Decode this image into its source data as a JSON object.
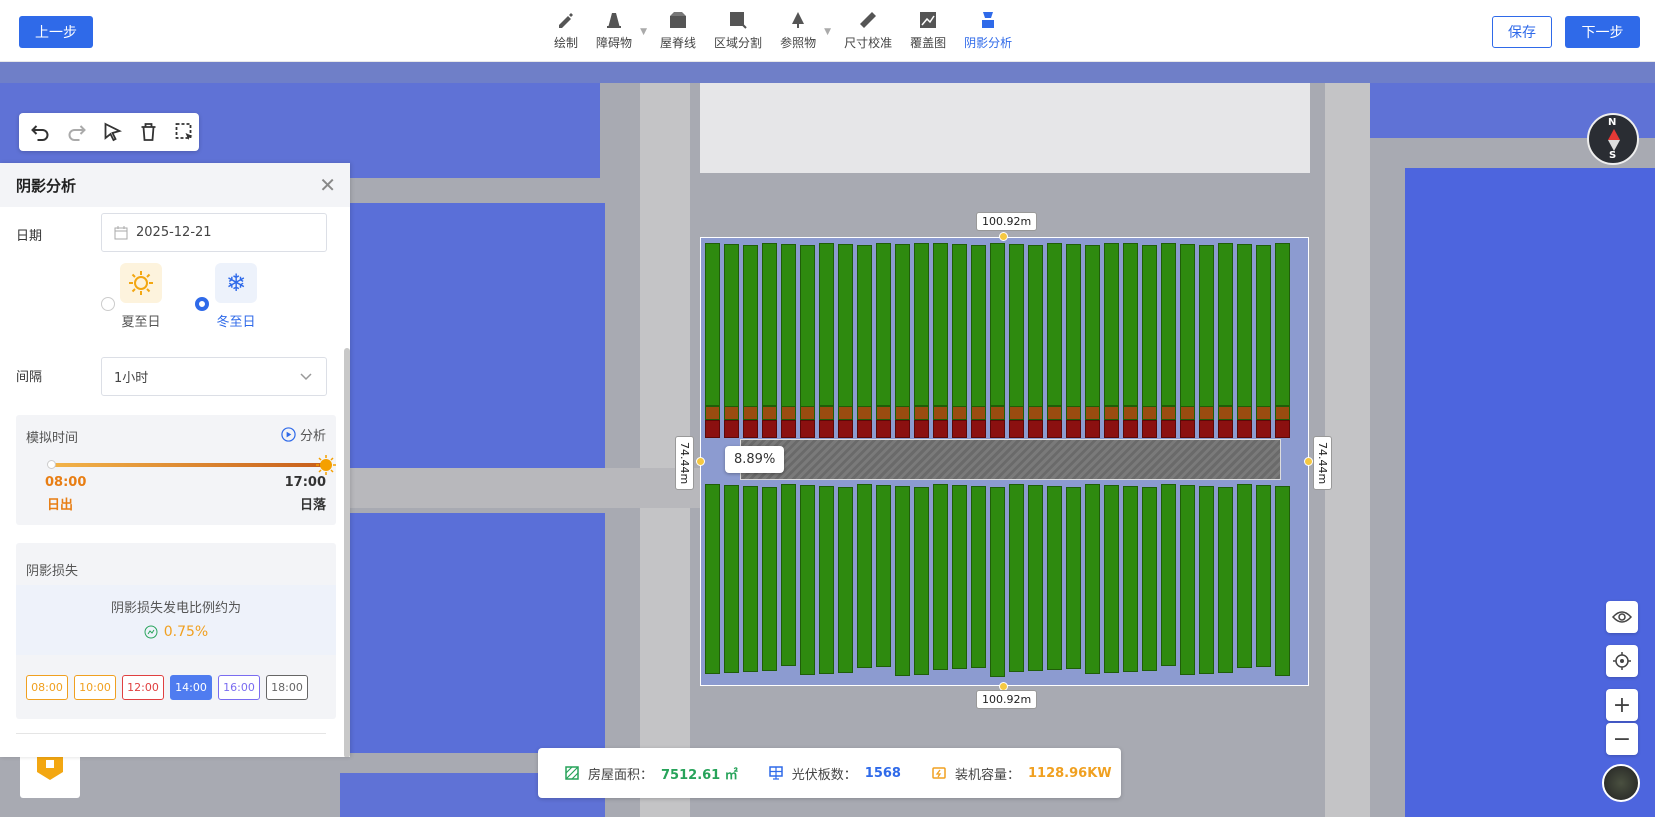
{
  "toolbar": {
    "prev_label": "上一步",
    "save_label": "保存",
    "next_label": "下一步",
    "tools": [
      {
        "label": "绘制",
        "icon": "pen-icon"
      },
      {
        "label": "障碍物",
        "icon": "obstacle-icon",
        "caret": true
      },
      {
        "label": "屋脊线",
        "icon": "ridge-icon"
      },
      {
        "label": "区域分割",
        "icon": "split-icon"
      },
      {
        "label": "参照物",
        "icon": "tree-icon",
        "caret": true
      },
      {
        "label": "尺寸校准",
        "icon": "ruler-icon"
      },
      {
        "label": "覆盖图",
        "icon": "overlay-icon"
      },
      {
        "label": "阴影分析",
        "icon": "shadow-icon",
        "active": true
      }
    ]
  },
  "panel": {
    "title": "阴影分析",
    "date_label": "日期",
    "date_value": "2025-12-21",
    "summer_label": "夏至日",
    "winter_label": "冬至日",
    "selected_season": "winter",
    "interval_label": "间隔",
    "interval_value": "1小时",
    "sim_label": "模拟时间",
    "analyze_label": "分析",
    "start_time": "08:00",
    "end_time": "17:00",
    "sunrise_label": "日出",
    "sunset_label": "日落",
    "slider_progress": 1.0,
    "loss_title": "阴影损失",
    "loss_desc": "阴影损失发电比例约为",
    "loss_value": "0.75%",
    "time_buttons": [
      {
        "label": "08:00",
        "color": "#f0a020"
      },
      {
        "label": "10:00",
        "color": "#f0a020"
      },
      {
        "label": "12:00",
        "color": "#e04040"
      },
      {
        "label": "14:00",
        "color": "#4f7cf0",
        "active": true
      },
      {
        "label": "16:00",
        "color": "#7a6cf0"
      },
      {
        "label": "18:00",
        "color": "#666666"
      }
    ]
  },
  "map": {
    "dim_top": "100.92m",
    "dim_bottom": "100.92m",
    "dim_left": "74.44m",
    "dim_right": "74.44m",
    "obstacle_pct": "8.89%",
    "compass_n": "N",
    "compass_s": "S"
  },
  "stats": {
    "area_label": "房屋面积：",
    "area_value": "7512.61 ㎡",
    "panels_label": "光伏板数：",
    "panels_value": "1568",
    "capacity_label": "装机容量：",
    "capacity_value": "1128.96KW",
    "colors": {
      "area": "#27a35a",
      "panels": "#2f6ae9",
      "capacity": "#f0a020"
    }
  }
}
